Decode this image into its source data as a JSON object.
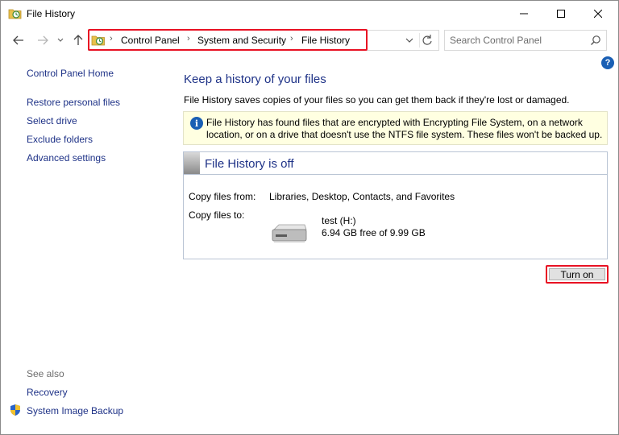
{
  "window": {
    "title": "File History",
    "icon": "file-history-icon",
    "controls": [
      "minimize-icon",
      "maximize-icon",
      "close-icon"
    ]
  },
  "nav": {
    "back_icon": "arrow-left-icon",
    "forward_icon": "arrow-right-icon",
    "recent_icon": "chevron-down-icon",
    "up_icon": "arrow-up-icon"
  },
  "address": {
    "crumbs": [
      "Control Panel",
      "System and Security",
      "File History"
    ],
    "separator": "›",
    "highlight_color": "#e81123"
  },
  "search": {
    "placeholder": "Search Control Panel"
  },
  "sidebar": {
    "home": "Control Panel Home",
    "items": [
      {
        "label": "Restore personal files"
      },
      {
        "label": "Select drive"
      },
      {
        "label": "Exclude folders"
      },
      {
        "label": "Advanced settings"
      }
    ],
    "see_also_label": "See also",
    "see_also": [
      {
        "label": "Recovery"
      },
      {
        "label": "System Image Backup"
      }
    ]
  },
  "main": {
    "title": "Keep a history of your files",
    "description": "File History saves copies of your files so you can get them back if they're lost or damaged.",
    "info": "File History has found files that are encrypted with Encrypting File System, on a network location, or on a drive that doesn't use the NTFS file system. These files won't be backed up.",
    "status_title": "File History is off",
    "copy_from_label": "Copy files from:",
    "copy_from_value": "Libraries, Desktop, Contacts, and Favorites",
    "copy_to_label": "Copy files to:",
    "drive_name": "test (H:)",
    "drive_space": "6.94 GB free of 9.99 GB",
    "turn_on_label": "Turn on"
  },
  "colors": {
    "link": "#1e3287",
    "accent": "#1a5fb4",
    "info_bg": "#ffffe1",
    "highlight": "#e81123"
  }
}
